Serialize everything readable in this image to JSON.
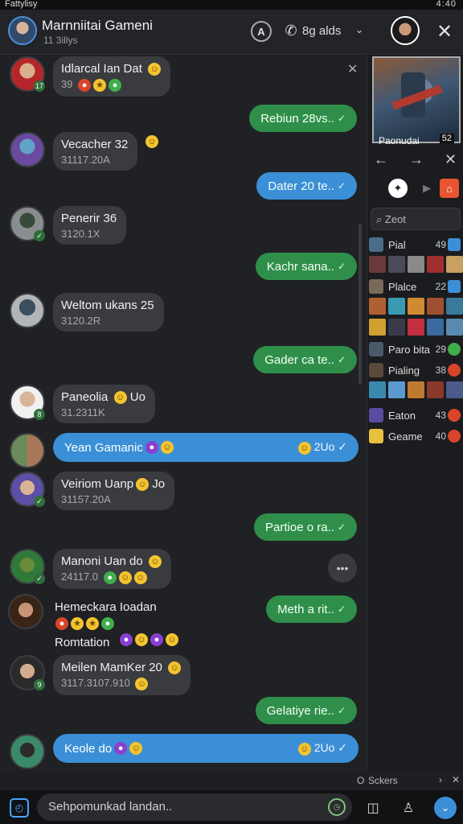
{
  "status_bar": {
    "left": "Fattylisy",
    "right": "4:40"
  },
  "header": {
    "title": "Marnniitai Gameni",
    "subtitle": "11 3illys",
    "call_label": "8g alds",
    "profile_icon": "profile-icon",
    "phone_icon": "phone-icon",
    "close_icon": "close-icon"
  },
  "messages": [
    {
      "name": "Idlarcal Ian Dat",
      "meta": "39"
    },
    {
      "out": "Rebiun 28vs.."
    },
    {
      "name": "Vecacher 32",
      "meta": "31117.20A"
    },
    {
      "out": "Dater 20 te.."
    },
    {
      "name": "Penerir 36",
      "meta": "3120.1X"
    },
    {
      "out": "Kachr sana.."
    },
    {
      "name": "Weltom ukans 25",
      "meta": "3120.2R"
    },
    {
      "out": "Gader ca te.."
    },
    {
      "name": "Paneolia",
      "name_suffix": "Uo",
      "meta": "31.2311K"
    },
    {
      "wide": "Yean Gamanic",
      "wide_right": "2Uo"
    },
    {
      "name": "Veiriom Uanp",
      "name_suffix": "Jo",
      "meta": "31157.20A"
    },
    {
      "out": "Partioe o ra.."
    },
    {
      "name": "Manoni Uan do",
      "meta": "24117.0"
    },
    {
      "name": "Hemeckara Ioadan",
      "meta2": "Romtation",
      "out": "Meth a rit.."
    },
    {
      "name": "Meilen MamKer 20",
      "meta": "3117.3107.910"
    },
    {
      "out": "Gelatiye rie.."
    },
    {
      "wide": "Keole do",
      "wide_right": "2Uo"
    }
  ],
  "side": {
    "banner_caption": "Paonudai",
    "banner_tag": "52",
    "search_placeholder": "Zeot",
    "games": [
      {
        "name": "Pial",
        "count": "49"
      },
      {
        "name": "Plalce",
        "count": "22"
      },
      {
        "name": "Paro bita",
        "count": "29"
      },
      {
        "name": "Pialing",
        "count": "38"
      },
      {
        "name": "Eaton",
        "count": "43"
      },
      {
        "name": "Geame",
        "count": "40"
      }
    ]
  },
  "stickers_label": "Sckers",
  "input": {
    "placeholder": "Sehpomunkad landan.."
  },
  "colors": {
    "outgoing": "#2f8f4a",
    "highlight": "#3b8fd6",
    "incoming": "#3a3b3f"
  }
}
